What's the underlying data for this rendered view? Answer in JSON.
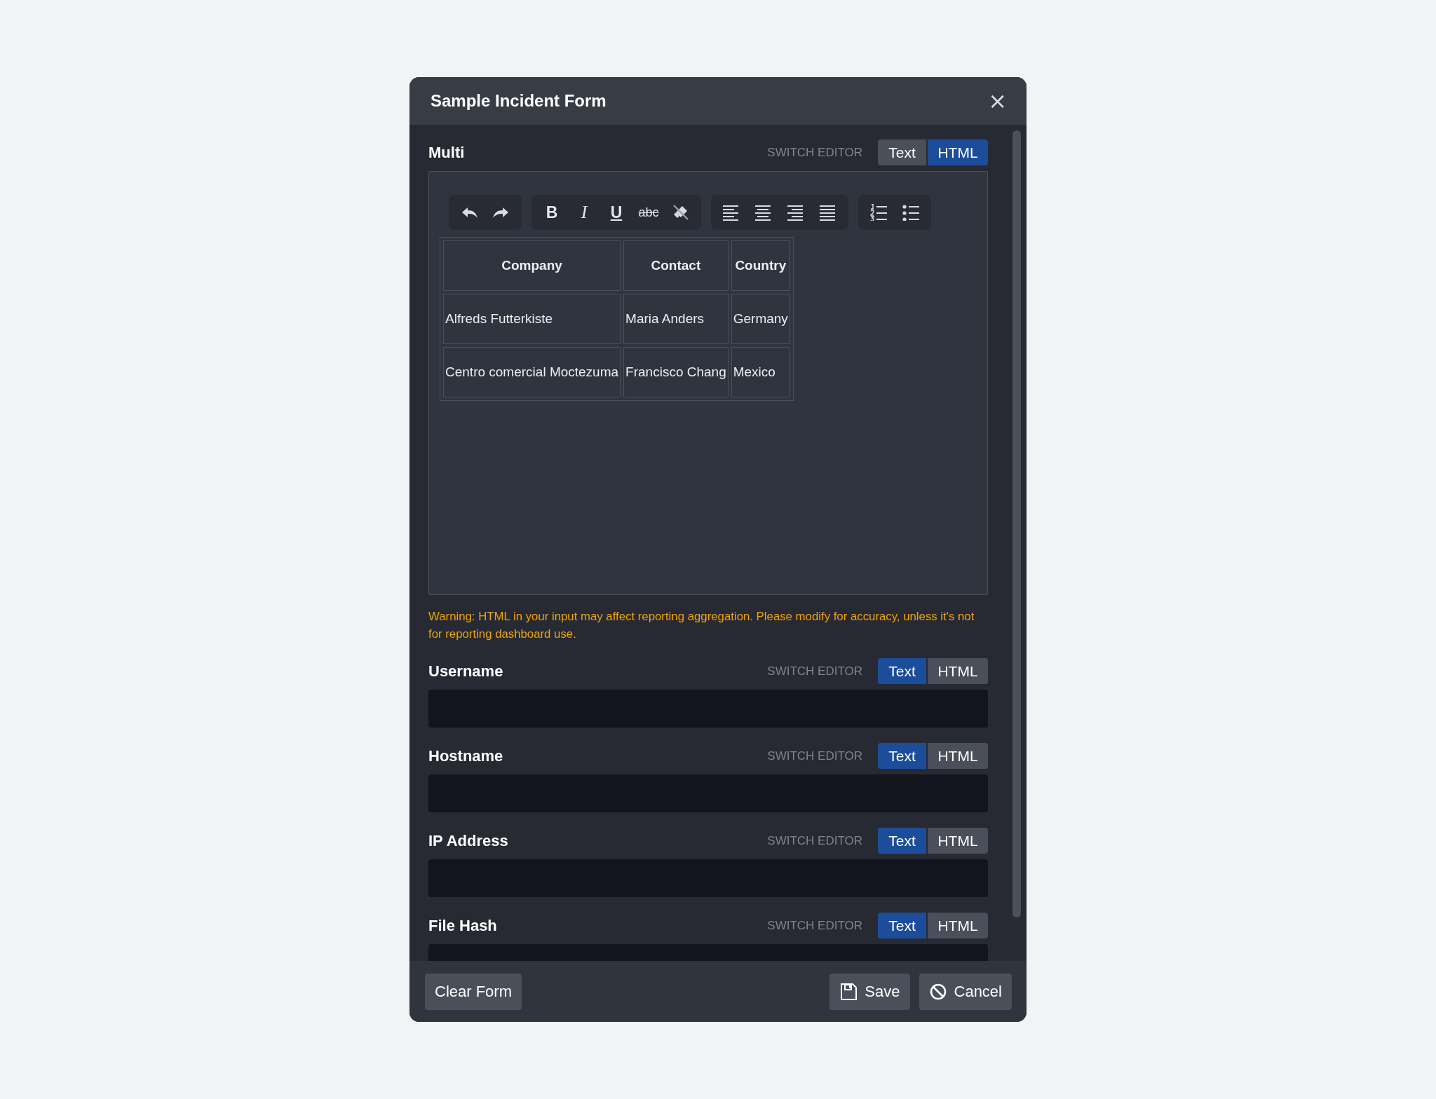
{
  "dialog": {
    "title": "Sample Incident Form",
    "close": "×"
  },
  "fields": [
    {
      "kind": "rich",
      "label": "Multi",
      "switch_label": "SWITCH EDITOR",
      "modes": [
        {
          "label": "Text",
          "selected": false
        },
        {
          "label": "HTML",
          "selected": true
        }
      ],
      "toolbar": [
        [
          {
            "kind": "undo"
          },
          {
            "kind": "redo"
          }
        ],
        [
          {
            "kind": "bold",
            "glyph": "B"
          },
          {
            "kind": "italic",
            "glyph": "I"
          },
          {
            "kind": "underline",
            "glyph": "U"
          },
          {
            "kind": "strike",
            "glyph": "abc"
          },
          {
            "kind": "eraser"
          }
        ],
        [
          {
            "kind": "align-left"
          },
          {
            "kind": "align-center"
          },
          {
            "kind": "align-right"
          },
          {
            "kind": "justify"
          }
        ],
        [
          {
            "kind": "ordered-list"
          },
          {
            "kind": "bullet-list"
          }
        ]
      ],
      "table": {
        "columns": [
          "Company",
          "Contact",
          "Country"
        ],
        "rows": [
          [
            "Alfreds Futterkiste",
            "Maria Anders",
            "Germany"
          ],
          [
            "Centro comercial Moctezuma",
            "Francisco Chang",
            "Mexico"
          ]
        ]
      },
      "warning": "Warning: HTML in your input may affect reporting aggregation. Please modify for accuracy, unless it's not for reporting dashboard use."
    },
    {
      "kind": "text",
      "label": "Username",
      "switch_label": "SWITCH EDITOR",
      "modes": [
        {
          "label": "Text",
          "selected": true
        },
        {
          "label": "HTML",
          "selected": false
        }
      ]
    },
    {
      "kind": "text",
      "label": "Hostname",
      "switch_label": "SWITCH EDITOR",
      "modes": [
        {
          "label": "Text",
          "selected": true
        },
        {
          "label": "HTML",
          "selected": false
        }
      ]
    },
    {
      "kind": "text",
      "label": "IP Address",
      "switch_label": "SWITCH EDITOR",
      "modes": [
        {
          "label": "Text",
          "selected": true
        },
        {
          "label": "HTML",
          "selected": false
        }
      ]
    },
    {
      "kind": "text",
      "label": "File Hash",
      "switch_label": "SWITCH EDITOR",
      "modes": [
        {
          "label": "Text",
          "selected": true
        },
        {
          "label": "HTML",
          "selected": false
        }
      ]
    }
  ],
  "footer": {
    "clear": "Clear Form",
    "actions": [
      {
        "kind": "save",
        "label": "Save"
      },
      {
        "kind": "cancel",
        "label": "Cancel"
      }
    ]
  }
}
